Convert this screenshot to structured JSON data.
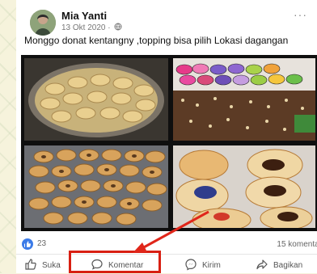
{
  "post": {
    "author": "Mia Yanti",
    "date": "13 Okt 2020 ·",
    "caption": "Monggo donat kentangny ,topping bisa pilih Lokasi dagangan",
    "more": "···"
  },
  "stats": {
    "likes": "23",
    "comments": "15 komentar"
  },
  "actions": {
    "like": "Suka",
    "comment": "Komentar",
    "send": "Kirim",
    "share": "Bagikan"
  },
  "colors": {
    "brand_blue": "#3b7be8",
    "highlight_red": "#d81f12"
  },
  "icons": {
    "globe": "globe-icon",
    "like": "thumbs-up-icon",
    "comment": "comment-bubble-icon",
    "send": "messenger-icon",
    "share": "share-arrow-icon"
  }
}
